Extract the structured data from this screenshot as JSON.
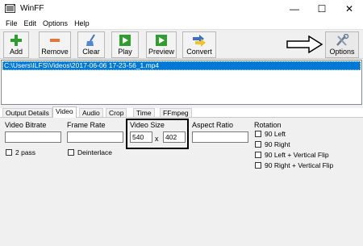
{
  "window": {
    "title": "WinFF",
    "minimize_glyph": "—",
    "maximize_glyph": "☐",
    "close_glyph": "✕"
  },
  "menu": [
    "File",
    "Edit",
    "Options",
    "Help"
  ],
  "toolbar": {
    "add": "Add",
    "remove": "Remove",
    "clear": "Clear",
    "play": "Play",
    "preview": "Preview",
    "convert": "Convert",
    "options": "Options"
  },
  "files": [
    "C:\\Users\\ILFS\\Videos\\2017-06-06 17-23-56_1.mp4"
  ],
  "tabs": [
    "Output Details",
    "Video",
    "Audio",
    "Crop",
    "Time",
    "FFmpeg"
  ],
  "video": {
    "bitrate_label": "Video Bitrate",
    "bitrate_value": "",
    "framerate_label": "Frame Rate",
    "framerate_value": "",
    "size_label": "Video Size",
    "width_value": "540",
    "height_value": "402",
    "size_sep": "x",
    "aspect_label": "Aspect Ratio",
    "aspect_value": "",
    "twopass_label": "2 pass",
    "deinterlace_label": "Deinterlace",
    "rotation_label": "Rotation",
    "rotation_options": [
      "90 Left",
      "90 Right",
      "90 Left + Vertical Flip",
      "90 Right + Vertical Flip"
    ]
  },
  "colors": {
    "selection": "#0078d7",
    "green_icon": "#2e9e2e",
    "red_icon": "#d9534f",
    "convert_blue": "#3a6fc4",
    "convert_yellow": "#f2c12e"
  },
  "icons": {
    "add": "plus-icon",
    "remove": "minus-icon",
    "clear": "broom-icon",
    "play": "play-icon",
    "preview": "preview-icon",
    "convert": "convert-arrows-icon",
    "options": "tools-icon",
    "annotation": "outline-arrow-icon"
  }
}
